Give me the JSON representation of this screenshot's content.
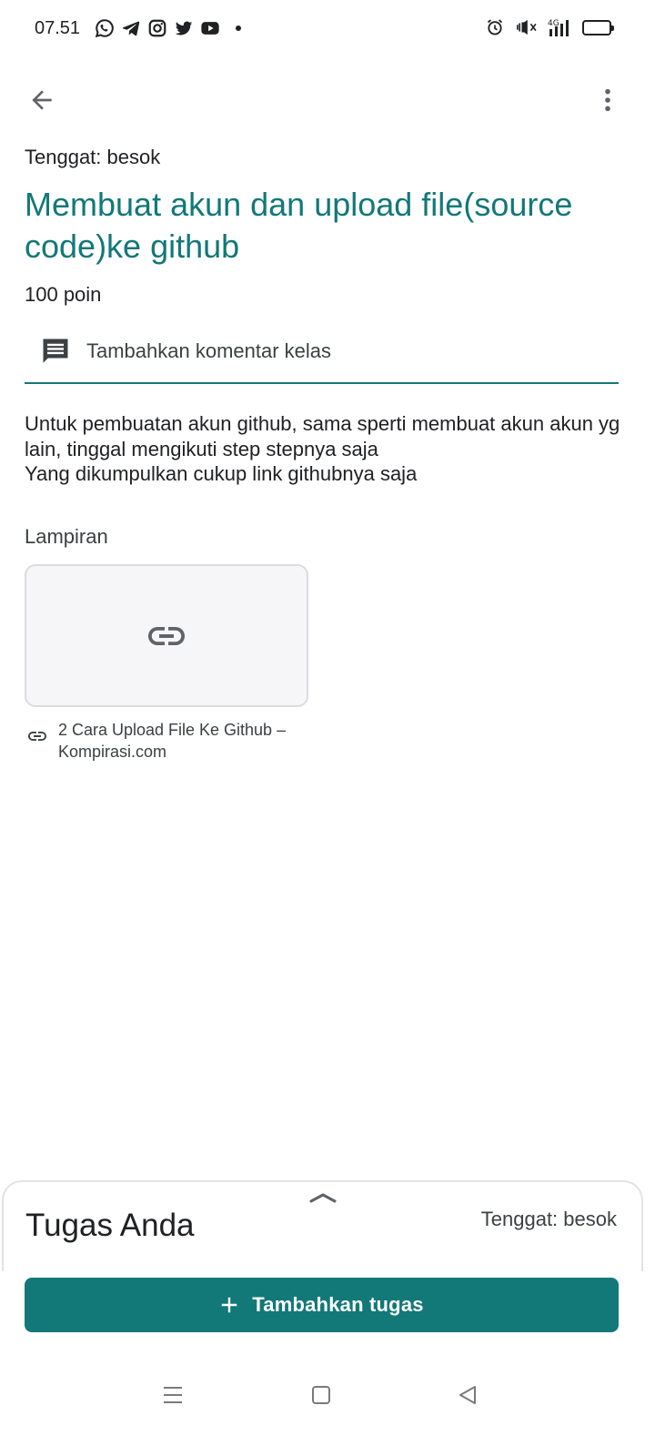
{
  "status_bar": {
    "time": "07.51",
    "app_icons": [
      "whatsapp-icon",
      "telegram-icon",
      "instagram-icon",
      "twitter-icon",
      "youtube-icon"
    ],
    "system_icons": [
      "alarm-icon",
      "mute-icon",
      "signal-4g-icon",
      "battery-icon"
    ],
    "network": "4G"
  },
  "toolbar": {
    "back_icon": "arrow-back-icon",
    "more_icon": "more-vert-icon"
  },
  "assignment": {
    "due": "Tenggat: besok",
    "title": "Membuat akun dan upload file(source code)ke github",
    "points": "100 poin",
    "comment_label": "Tambahkan komentar kelas",
    "description": "Untuk pembuatan akun github, sama sperti membuat akun akun yg lain, tinggal mengikuti step stepnya saja\nYang dikumpulkan cukup link githubnya saja"
  },
  "attachments": {
    "heading": "Lampiran",
    "items": [
      {
        "title": "2 Cara Upload File Ke Github – Kompirasi.com",
        "icon": "link-icon"
      }
    ]
  },
  "your_work": {
    "title": "Tugas Anda",
    "due": "Tenggat: besok",
    "add_button": "Tambahkan tugas"
  },
  "colors": {
    "accent": "#137878",
    "text": "#202124",
    "secondary_text": "#3c4043",
    "card_bg": "#f6f6f8",
    "card_border": "#dadce0"
  }
}
